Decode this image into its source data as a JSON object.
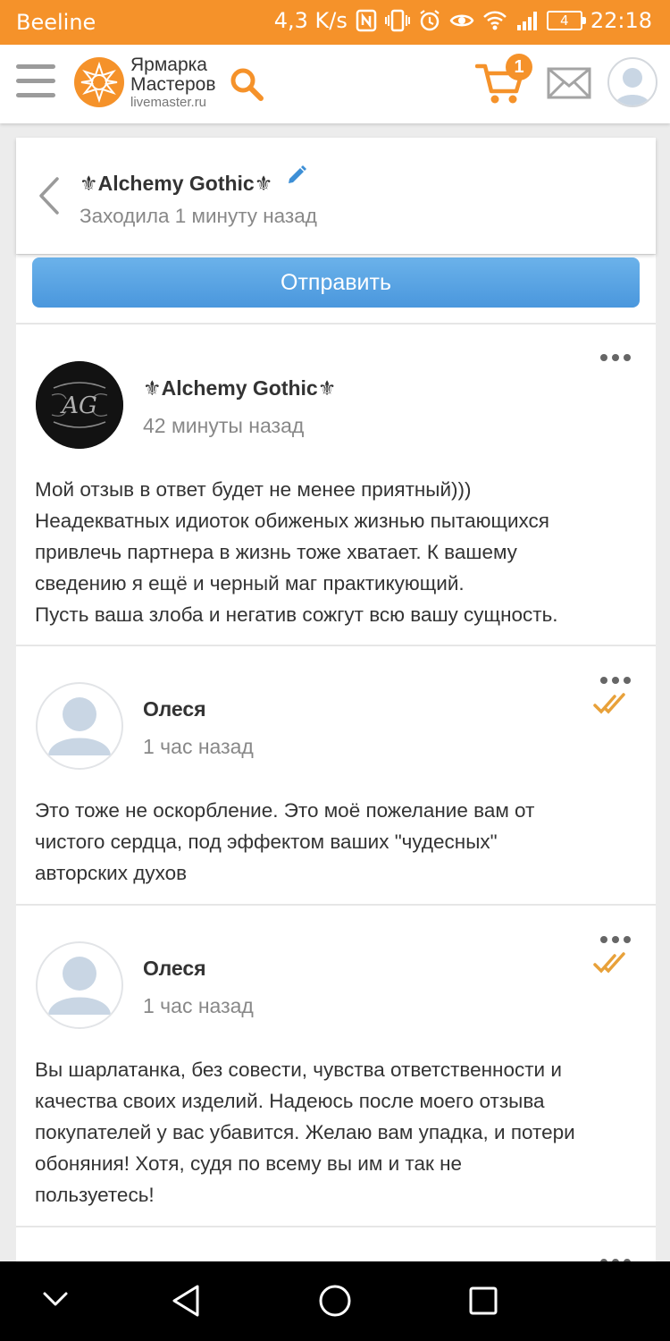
{
  "status_bar": {
    "carrier": "Beeline",
    "speed": "4,3 K/s",
    "battery": "4",
    "time": "22:18"
  },
  "header": {
    "logo_line1": "Ярмарка",
    "logo_line2": "Мастеров",
    "logo_domain": "livemaster.ru",
    "cart_count": "1"
  },
  "chat": {
    "title": "⚜Alchemy Gothic⚜",
    "subtitle": "Заходила 1 минуту назад"
  },
  "send_button": "Отправить",
  "messages": [
    {
      "author": "⚜Alchemy Gothic⚜",
      "avatar_text": "AG",
      "time": "42 минуты назад",
      "lines": [
        "Мой отзыв в ответ будет не менее приятный)))",
        "Неадекватных идиоток обиженых жизнью пытающихся",
        "привлечь партнера в жизнь тоже хватает. К вашему",
        "сведению я ещё и черный маг практикующий.",
        "Пусть ваша злоба и негатив сожгут всю вашу сущность."
      ]
    },
    {
      "author": "Олеся",
      "time": "1 час назад",
      "lines": [
        "Это тоже не оскорбление. Это моё пожелание вам от",
        "чистого сердца, под эффектом ваших \"чудесных\"",
        "авторских духов"
      ]
    },
    {
      "author": "Олеся",
      "time": "1 час назад",
      "lines": [
        "Вы шарлатанка, без совести, чувства ответственности и",
        "качества своих изделий. Надеюсь после моего отзыва",
        "покупателей у вас убавится. Желаю вам упадка, и потери",
        "обоняния! Хотя, судя по всему вы им и так не",
        "пользуетесь!"
      ]
    }
  ],
  "colors": {
    "brand": "#f5922a",
    "button": "#4a97dd",
    "check": "#e8a13a"
  }
}
